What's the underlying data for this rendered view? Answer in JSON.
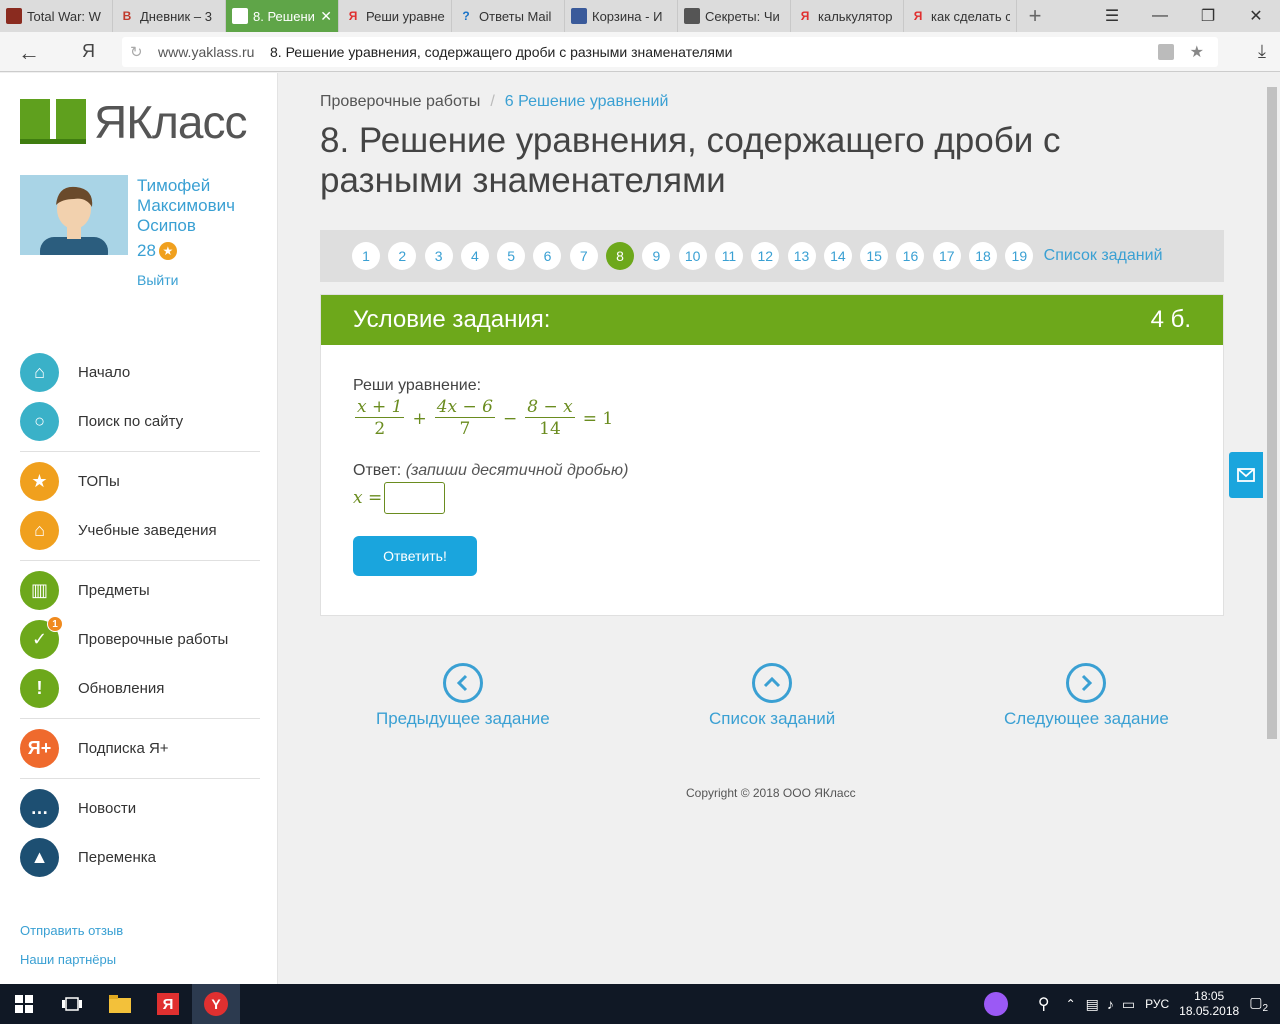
{
  "browser": {
    "tabs": [
      {
        "title": "Total War: W",
        "icon": "tw",
        "color": "#8a2b1f"
      },
      {
        "title": "Дневник – 3",
        "icon": "B",
        "color": "#c0392b"
      },
      {
        "title": "8. Решени",
        "icon": "ya",
        "color": "#ffffff",
        "active": true
      },
      {
        "title": "Реши уравне",
        "icon": "Я",
        "color": "#e03030"
      },
      {
        "title": "Ответы Mail",
        "icon": "?",
        "color": "#1a73c8"
      },
      {
        "title": "Корзина - И",
        "icon": "cart",
        "color": "#3a5a9a"
      },
      {
        "title": "Секреты: Чи",
        "icon": "box",
        "color": "#555555"
      },
      {
        "title": "калькулятор",
        "icon": "Я",
        "color": "#e03030"
      },
      {
        "title": "как сделать с",
        "icon": "Я",
        "color": "#e03030"
      }
    ],
    "host": "www.yaklass.ru",
    "page_title": "8. Решение уравнения, содержащего дроби с разными знаменателями"
  },
  "sidebar": {
    "logo": "ЯКласс",
    "user_name": "Тимофей Максимович Осипов",
    "points": "28",
    "logout": "Выйти",
    "menu": [
      {
        "label": "Начало",
        "icon": "home-icon",
        "color": "#3ab1c8"
      },
      {
        "label": "Поиск по сайту",
        "icon": "search-icon",
        "color": "#3ab1c8"
      },
      {
        "label": "ТОПы",
        "icon": "star-icon",
        "color": "#f0a01e"
      },
      {
        "label": "Учебные заведения",
        "icon": "building-icon",
        "color": "#f0a01e"
      },
      {
        "label": "Предметы",
        "icon": "book-icon",
        "color": "#6da81b"
      },
      {
        "label": "Проверочные работы",
        "icon": "check-icon",
        "color": "#6da81b",
        "badge": "1"
      },
      {
        "label": "Обновления",
        "icon": "exclamation-icon",
        "color": "#6da81b"
      },
      {
        "label": "Подписка Я+",
        "icon": "yaplus-icon",
        "color": "#ef6a2d"
      },
      {
        "label": "Новости",
        "icon": "chat-icon",
        "color": "#1d4f72"
      },
      {
        "label": "Переменка",
        "icon": "bell-icon",
        "color": "#1d4f72"
      }
    ],
    "feedback": "Отправить отзыв",
    "partners": "Наши партнёры"
  },
  "breadcrumb": {
    "root": "Проверочные работы",
    "current": "6 Решение уравнений"
  },
  "title": "8. Решение уравнения, содержащего дроби с разными знаменателями",
  "pager": {
    "pages": [
      "1",
      "2",
      "3",
      "4",
      "5",
      "6",
      "7",
      "8",
      "9",
      "10",
      "11",
      "12",
      "13",
      "14",
      "15",
      "16",
      "17",
      "18",
      "19"
    ],
    "current": "8",
    "list_label": "Список заданий"
  },
  "task": {
    "header": "Условие задания:",
    "points": "4 б.",
    "question": "Реши уравнение:",
    "equation": {
      "f1n": "x + 1",
      "f1d": "2",
      "op1": "+",
      "f2n": "4x − 6",
      "f2d": "7",
      "op2": "−",
      "f3n": "8 − x",
      "f3d": "14",
      "rhs": "= 1"
    },
    "answer_label": "Ответ:",
    "answer_hint": "(запиши десятичной дробью)",
    "answer_var": "x =",
    "answer_value": "",
    "submit": "Ответить!"
  },
  "nav": {
    "prev": "Предыдущее задание",
    "list": "Список заданий",
    "next": "Следующее задание"
  },
  "copyright": "Copyright © 2018 ООО ЯКласс",
  "taskbar": {
    "lang": "РУС",
    "time": "18:05",
    "date": "18.05.2018",
    "notifications": "2"
  }
}
